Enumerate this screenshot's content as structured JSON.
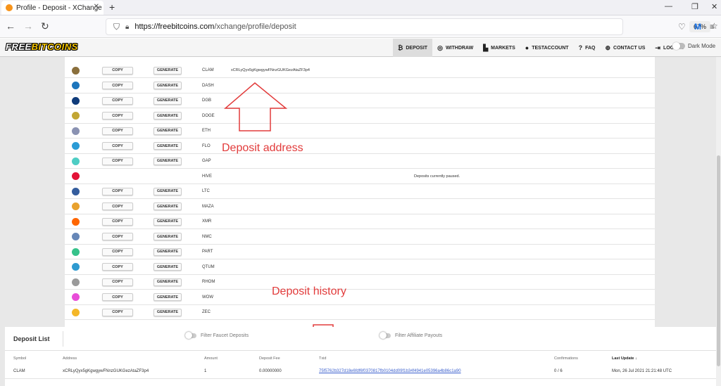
{
  "browser": {
    "tab_title": "Profile - Deposit - XChange",
    "tab_close": "✕",
    "new_tab": "+",
    "url_host": "https://freebitcoins.com",
    "url_path": "/xchange/profile/deposit",
    "zoom": "67%"
  },
  "site": {
    "logo_free": "FREE",
    "logo_bitcoins": "BITCOINS",
    "nav": [
      {
        "label": "DEPOSIT",
        "icon": "₿"
      },
      {
        "label": "WITHDRAW",
        "icon": "◎"
      },
      {
        "label": "MARKETS",
        "icon": "▙"
      },
      {
        "label": "TESTACCOUNT",
        "icon": "●"
      },
      {
        "label": "FAQ",
        "icon": "?"
      },
      {
        "label": "CONTACT US",
        "icon": "⊕"
      },
      {
        "label": "LOGOUT",
        "icon": "⇥"
      }
    ],
    "dark_mode": "Dark Mode"
  },
  "coins": {
    "copy_label": "COPY",
    "generate_label": "GENERATE",
    "rows": [
      {
        "symbol": "CLAM",
        "address": "xCRLyQyx5gKgwgywFNnzGUKGezAtaZF3p4",
        "icon_color": "#8a6f3c",
        "buttons": true
      },
      {
        "symbol": "DASH",
        "address": "",
        "icon_color": "#1c75bc",
        "buttons": true
      },
      {
        "symbol": "DGB",
        "address": "",
        "icon_color": "#0f3b7a",
        "buttons": true
      },
      {
        "symbol": "DOGE",
        "address": "",
        "icon_color": "#c2a633",
        "buttons": true
      },
      {
        "symbol": "ETH",
        "address": "",
        "icon_color": "#8a92b2",
        "buttons": true
      },
      {
        "symbol": "FLO",
        "address": "",
        "icon_color": "#2b9bd6",
        "buttons": true
      },
      {
        "symbol": "GAP",
        "address": "",
        "icon_color": "#4ecdc4",
        "buttons": true
      },
      {
        "symbol": "HIVE",
        "address": "",
        "icon_color": "#e31337",
        "buttons": false,
        "note": "Deposits currently paused."
      },
      {
        "symbol": "LTC",
        "address": "",
        "icon_color": "#345d9d",
        "buttons": true
      },
      {
        "symbol": "MAZA",
        "address": "",
        "icon_color": "#e8a12e",
        "buttons": true
      },
      {
        "symbol": "XMR",
        "address": "",
        "icon_color": "#ff6600",
        "buttons": true
      },
      {
        "symbol": "NMC",
        "address": "",
        "icon_color": "#6787b7",
        "buttons": true
      },
      {
        "symbol": "PART",
        "address": "",
        "icon_color": "#36c28a",
        "buttons": true
      },
      {
        "symbol": "QTUM",
        "address": "",
        "icon_color": "#2e9ad0",
        "buttons": true
      },
      {
        "symbol": "RHOM",
        "address": "",
        "icon_color": "#9a9a9a",
        "buttons": true
      },
      {
        "symbol": "WOW",
        "address": "",
        "icon_color": "#e84dd8",
        "buttons": true
      },
      {
        "symbol": "ZEC",
        "address": "",
        "icon_color": "#f4b728",
        "buttons": true
      }
    ]
  },
  "annotations": {
    "deposit_address": "Deposit address",
    "deposit_history": "Deposit history"
  },
  "deposit_list": {
    "title": "Deposit List",
    "filter_faucet": "Filter Faucet Deposits",
    "filter_affiliate": "Filter Affiliate Payouts",
    "columns": [
      "Symbol",
      "Address",
      "Amount",
      "Deposit Fee",
      "Txid",
      "Confirmations",
      "Last Update"
    ],
    "row": {
      "symbol": "CLAM",
      "address": "xCRLyQyx5gKgwgywFNnzGUKGezAtaZF3p4",
      "amount": "1",
      "fee": "0.00000000",
      "txid": "75f5762b327d18e6fdf6f0370817fb0104dd09f1b34f4941e05396a4b86c1a90",
      "confirmations": "0 / 6",
      "last_update": "Mon, 26 Jul 2021 21:21:48 UTC"
    }
  }
}
